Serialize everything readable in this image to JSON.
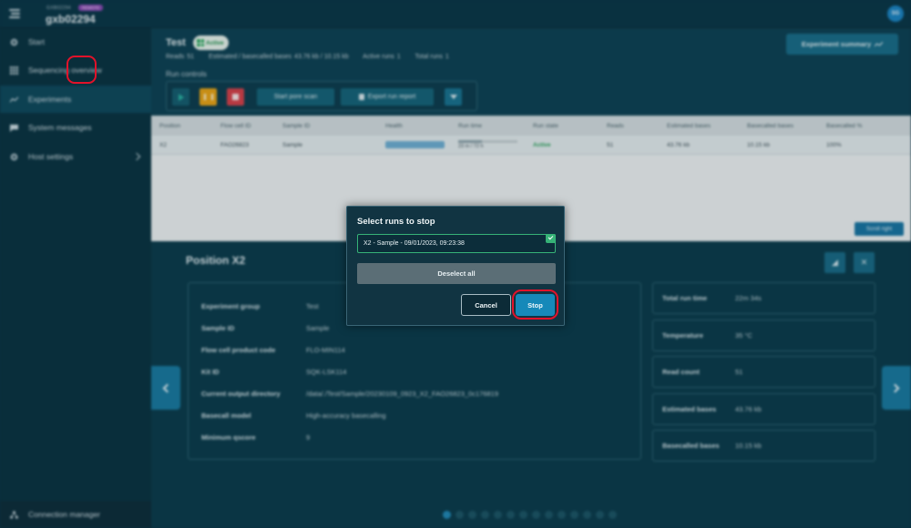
{
  "topbar": {
    "host_small": "GXB02294",
    "remote_badge": "REMOTE",
    "host_name": "gxb02294",
    "avatar_initials": "SG"
  },
  "sidebar": {
    "items": [
      {
        "label": "Start",
        "icon": "gear-icon"
      },
      {
        "label": "Sequencing overview",
        "icon": "grid-icon"
      },
      {
        "label": "Experiments",
        "icon": "chart-line-icon"
      },
      {
        "label": "System messages",
        "icon": "message-icon"
      },
      {
        "label": "Host settings",
        "icon": "gear-icon"
      }
    ],
    "bottom_label": "Connection manager"
  },
  "experiment": {
    "title": "Test",
    "status": "Active",
    "reads_label": "Reads",
    "reads_value": "51",
    "est_label": "Estimated / basecalled bases",
    "est_value": "43.76 kb / 10.15 kb",
    "active_runs_label": "Active runs",
    "active_runs_value": "1",
    "total_runs_label": "Total runs",
    "total_runs_value": "1",
    "run_controls_label": "Run controls",
    "start_pore_scan": "Start pore scan",
    "export_run_report": "Export run report",
    "summary_button": "Experiment summary"
  },
  "table": {
    "headers": [
      "Position",
      "Flow cell ID",
      "Sample ID",
      "Health",
      "Run time",
      "Run state",
      "Reads",
      "Estimated bases",
      "Basecalled bases",
      "Basecalled %"
    ],
    "row": {
      "position": "X2",
      "flow_cell": "FAO26823",
      "sample": "Sample",
      "run_time": "23 m / 72 h",
      "run_state": "Active",
      "reads": "51",
      "estimated": "43.76 kb",
      "basecalled": "10.15 kb",
      "basecalled_pct": "100%"
    },
    "scroll_button": "Scroll right"
  },
  "position_panel": {
    "title": "Position X2",
    "details": [
      {
        "key": "Experiment group",
        "value": "Test"
      },
      {
        "key": "Sample ID",
        "value": "Sample"
      },
      {
        "key": "Flow cell product code",
        "value": "FLO-MIN114"
      },
      {
        "key": "Kit ID",
        "value": "SQK-LSK114"
      },
      {
        "key": "Current output directory",
        "value": "/data/./Test/Sample/20230109_0923_X2_FAO26823_0c176819"
      },
      {
        "key": "Basecall model",
        "value": "High-accuracy basecalling"
      },
      {
        "key": "Minimum qscore",
        "value": "9"
      }
    ],
    "stats": [
      {
        "key": "Total run time",
        "value": "22m 34s"
      },
      {
        "key": "Temperature",
        "value": "35 °C"
      },
      {
        "key": "Read count",
        "value": "51"
      },
      {
        "key": "Estimated bases",
        "value": "43.76 kb"
      },
      {
        "key": "Basecalled bases",
        "value": "10.15 kb"
      }
    ]
  },
  "modal": {
    "title": "Select runs to stop",
    "run_option": "X2 - Sample - 09/01/2023, 09:23:38",
    "deselect_all": "Deselect all",
    "cancel": "Cancel",
    "stop": "Stop"
  },
  "colors": {
    "accent": "#1689b9",
    "highlight_ring": "#e2122a",
    "active_green": "#36b277"
  }
}
